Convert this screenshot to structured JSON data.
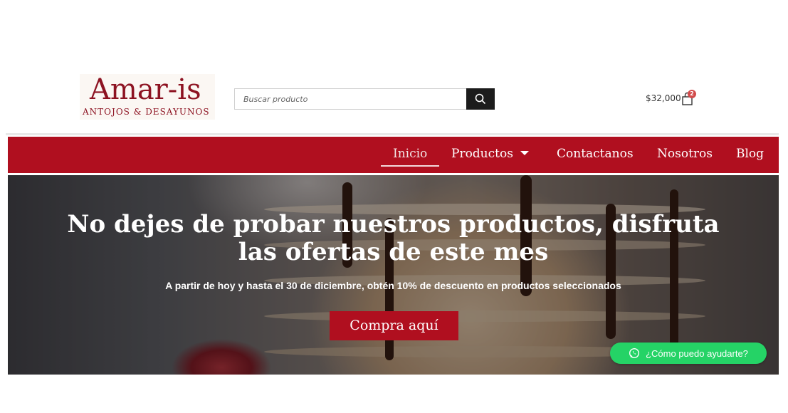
{
  "brand": {
    "name": "Amar-is",
    "tagline": "ANTOJOS & DESAYUNOS",
    "color": "#8d1322"
  },
  "search": {
    "placeholder": "Buscar producto",
    "icon": "search-icon"
  },
  "cart": {
    "total": "$32,000",
    "count": "2",
    "icon": "shopping-bag-icon"
  },
  "nav": {
    "items": [
      {
        "label": "Inicio",
        "active": true
      },
      {
        "label": "Productos",
        "has_dropdown": true
      },
      {
        "label": "Contactanos"
      },
      {
        "label": "Nosotros"
      },
      {
        "label": "Blog"
      }
    ],
    "background": "#b00f1f"
  },
  "hero": {
    "title": "No dejes de probar nuestros productos, disfruta las ofertas de este mes",
    "subtitle": "A partir de hoy y hasta el 30 de diciembre, obtén 10% de descuento en productos seleccionados",
    "cta_label": "Compra aquí"
  },
  "whatsapp": {
    "label": "¿Cómo puedo ayudarte?",
    "icon": "whatsapp-icon",
    "color": "#25d366"
  }
}
